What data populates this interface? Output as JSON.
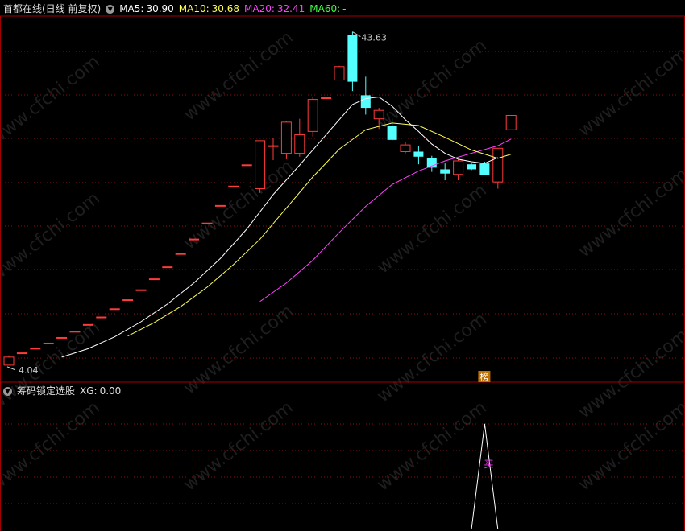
{
  "header": {
    "title": "首都在线(日线 前复权)",
    "indicators": [
      {
        "label": "MA5:",
        "value": "30.90",
        "color": "#ffffff"
      },
      {
        "label": "MA10:",
        "value": "30.68",
        "color": "#ffff55"
      },
      {
        "label": "MA20:",
        "value": "32.41",
        "color": "#ff44ff"
      },
      {
        "label": "MA60:",
        "value": "-",
        "color": "#44ff44"
      }
    ]
  },
  "sub_header": {
    "title": "筹码锁定选股",
    "indicator_label": "XG:",
    "indicator_value": "0.00"
  },
  "annotations": {
    "high": "43.63",
    "low": "4.04",
    "badge": "榜",
    "signal": "买"
  },
  "watermark": "www.cfchi.com",
  "colors": {
    "up": "#ff3b3b",
    "down": "#54ffff",
    "ma5": "#ffffff",
    "ma10": "#ffff55",
    "ma20": "#ff44ff",
    "grid": "#8a1010",
    "panel_border": "#a00000"
  },
  "chart_data": [
    {
      "type": "candlestick",
      "title": "首都在线(日线 前复权)",
      "ylim": [
        2.5,
        45.5
      ],
      "candles": [
        {
          "o": 4.04,
          "h": 5.2,
          "l": 4.04,
          "c": 5.0
        },
        {
          "o": 5.5,
          "h": 5.5,
          "l": 5.5,
          "c": 5.5
        },
        {
          "o": 6.05,
          "h": 6.05,
          "l": 6.05,
          "c": 6.05
        },
        {
          "o": 6.66,
          "h": 6.66,
          "l": 6.66,
          "c": 6.66
        },
        {
          "o": 7.33,
          "h": 7.33,
          "l": 7.33,
          "c": 7.33
        },
        {
          "o": 8.06,
          "h": 8.06,
          "l": 8.06,
          "c": 8.06
        },
        {
          "o": 8.87,
          "h": 8.87,
          "l": 8.87,
          "c": 8.87
        },
        {
          "o": 9.76,
          "h": 9.76,
          "l": 9.76,
          "c": 9.76
        },
        {
          "o": 10.74,
          "h": 10.74,
          "l": 10.74,
          "c": 10.74
        },
        {
          "o": 11.81,
          "h": 11.81,
          "l": 11.81,
          "c": 11.81
        },
        {
          "o": 12.99,
          "h": 12.99,
          "l": 12.99,
          "c": 12.99
        },
        {
          "o": 14.29,
          "h": 14.29,
          "l": 14.29,
          "c": 14.29
        },
        {
          "o": 15.72,
          "h": 15.72,
          "l": 15.72,
          "c": 15.72
        },
        {
          "o": 17.29,
          "h": 17.29,
          "l": 17.29,
          "c": 17.29
        },
        {
          "o": 19.02,
          "h": 19.02,
          "l": 19.02,
          "c": 19.02
        },
        {
          "o": 20.92,
          "h": 20.92,
          "l": 20.92,
          "c": 20.92
        },
        {
          "o": 23.01,
          "h": 23.01,
          "l": 23.01,
          "c": 23.01
        },
        {
          "o": 25.31,
          "h": 25.31,
          "l": 25.31,
          "c": 25.31
        },
        {
          "o": 27.84,
          "h": 27.84,
          "l": 27.84,
          "c": 27.84
        },
        {
          "o": 25.0,
          "h": 30.7,
          "l": 24.5,
          "c": 30.7
        },
        {
          "o": 30.1,
          "h": 31.0,
          "l": 28.4,
          "c": 30.1
        },
        {
          "o": 29.2,
          "h": 33.0,
          "l": 28.5,
          "c": 32.9
        },
        {
          "o": 29.2,
          "h": 33.3,
          "l": 28.8,
          "c": 31.4
        },
        {
          "o": 31.8,
          "h": 35.9,
          "l": 31.2,
          "c": 35.6
        },
        {
          "o": 35.8,
          "h": 35.8,
          "l": 35.8,
          "c": 35.8
        },
        {
          "o": 37.9,
          "h": 39.6,
          "l": 37.9,
          "c": 39.5
        },
        {
          "o": 43.3,
          "h": 43.63,
          "l": 36.6,
          "c": 37.7
        },
        {
          "o": 36.1,
          "h": 38.3,
          "l": 33.8,
          "c": 34.6
        },
        {
          "o": 33.3,
          "h": 34.6,
          "l": 32.1,
          "c": 34.3
        },
        {
          "o": 32.5,
          "h": 33.3,
          "l": 30.7,
          "c": 30.8
        },
        {
          "o": 29.4,
          "h": 30.6,
          "l": 29.2,
          "c": 30.2
        },
        {
          "o": 29.4,
          "h": 30.1,
          "l": 27.9,
          "c": 28.8
        },
        {
          "o": 28.6,
          "h": 28.9,
          "l": 27.0,
          "c": 27.5
        },
        {
          "o": 27.3,
          "h": 28.0,
          "l": 26.0,
          "c": 26.8
        },
        {
          "o": 26.7,
          "h": 28.5,
          "l": 26.0,
          "c": 28.3
        },
        {
          "o": 27.9,
          "h": 28.1,
          "l": 27.2,
          "c": 27.3
        },
        {
          "o": 28.0,
          "h": 28.2,
          "l": 26.8,
          "c": 26.6
        },
        {
          "o": 25.8,
          "h": 29.8,
          "l": 25.0,
          "c": 29.8
        },
        {
          "o": 32.0,
          "h": 33.7,
          "l": 32.0,
          "c": 33.7
        }
      ],
      "ma5": [
        [
          4,
          5.0
        ],
        [
          6,
          6.0
        ],
        [
          8,
          7.4
        ],
        [
          10,
          9.2
        ],
        [
          12,
          11.3
        ],
        [
          14,
          13.8
        ],
        [
          16,
          16.7
        ],
        [
          18,
          20.2
        ],
        [
          20,
          24.3
        ],
        [
          22,
          27.8
        ],
        [
          24,
          31.4
        ],
        [
          26,
          35.0
        ],
        [
          27,
          35.7
        ],
        [
          28,
          35.9
        ],
        [
          29,
          34.8
        ],
        [
          30,
          33.2
        ],
        [
          31,
          31.8
        ],
        [
          32,
          30.3
        ],
        [
          33,
          29.2
        ],
        [
          34,
          28.5
        ],
        [
          35,
          28.2
        ],
        [
          36,
          28.0
        ],
        [
          37,
          28.7
        ]
      ],
      "ma10": [
        [
          9,
          7.5
        ],
        [
          11,
          9.1
        ],
        [
          13,
          11.0
        ],
        [
          15,
          13.3
        ],
        [
          17,
          16.0
        ],
        [
          19,
          19.0
        ],
        [
          21,
          22.7
        ],
        [
          23,
          26.4
        ],
        [
          25,
          29.7
        ],
        [
          27,
          32.0
        ],
        [
          29,
          32.8
        ],
        [
          31,
          32.5
        ],
        [
          33,
          31.1
        ],
        [
          35,
          29.6
        ],
        [
          37,
          28.6
        ],
        [
          38,
          29.1
        ]
      ],
      "ma20": [
        [
          19,
          11.6
        ],
        [
          21,
          13.8
        ],
        [
          23,
          16.5
        ],
        [
          25,
          19.8
        ],
        [
          27,
          22.9
        ],
        [
          29,
          25.5
        ],
        [
          31,
          27.1
        ],
        [
          33,
          28.3
        ],
        [
          35,
          29.2
        ],
        [
          37,
          30.1
        ],
        [
          38,
          30.9
        ]
      ],
      "labels": {
        "max": "43.63",
        "min": "4.04"
      }
    },
    {
      "type": "line",
      "title": "筹码锁定选股",
      "series": [
        {
          "name": "XG",
          "values": [
            0,
            0,
            0,
            0,
            0,
            0,
            0,
            0,
            0,
            0,
            0,
            0,
            0,
            0,
            0,
            0,
            0,
            0,
            0,
            0,
            0,
            0,
            0,
            0,
            0,
            0,
            0,
            0,
            0,
            0,
            0,
            0,
            0,
            0,
            0,
            0,
            1,
            0,
            0
          ]
        }
      ],
      "ylim": [
        0,
        1.25
      ]
    }
  ]
}
